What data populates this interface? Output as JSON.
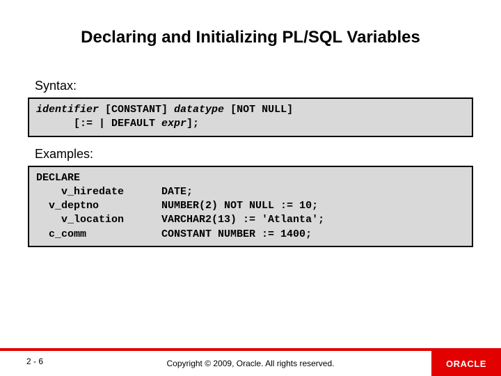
{
  "title": "Declaring and Initializing PL/SQL Variables",
  "syntax": {
    "label": "Syntax:",
    "line1_a": "identifier",
    "line1_b": " [CONSTANT] ",
    "line1_c": "datatype",
    "line1_d": " [NOT NULL]",
    "line2_a": "      [:= | DEFAULT ",
    "line2_b": "expr",
    "line2_c": "];"
  },
  "examples": {
    "label": "Examples:",
    "code": "DECLARE\n    v_hiredate      DATE;\n  v_deptno          NUMBER(2) NOT NULL := 10;\n    v_location      VARCHAR2(13) := 'Atlanta';\n  c_comm            CONSTANT NUMBER := 1400;"
  },
  "footer": {
    "page": "2 - 6",
    "copyright": "Copyright © 2009, Oracle. All rights reserved.",
    "logo": "ORACLE"
  }
}
